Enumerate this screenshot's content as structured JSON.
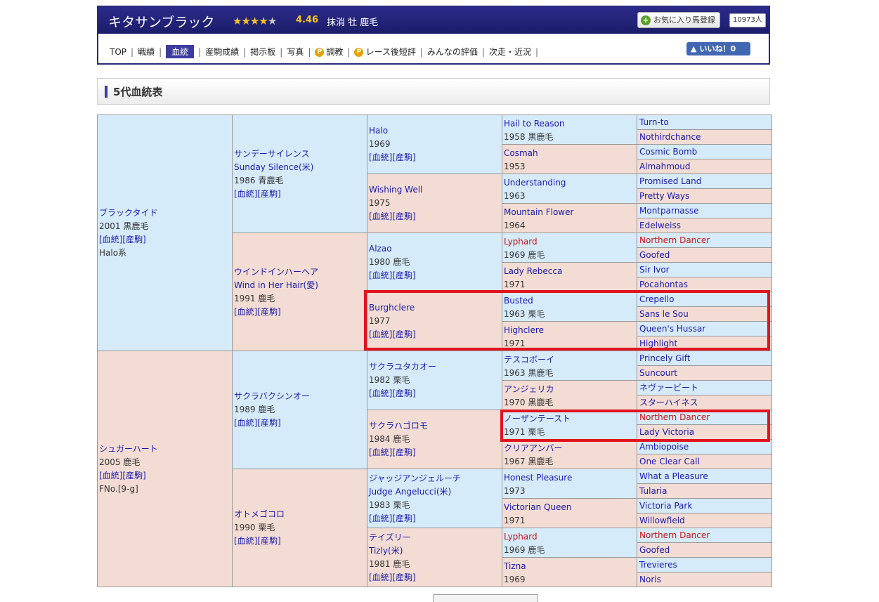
{
  "horse": {
    "name": "キタサンブラック",
    "rating": "4.46",
    "status": "抹消  牡  鹿毛",
    "stars": [
      "★",
      "★",
      "★",
      "★",
      "★"
    ],
    "favorite_label": "お気に入り馬登録",
    "favorite_count": "10973人",
    "like_label": "いいね！0"
  },
  "nav": {
    "top": "TOP",
    "results": "戦績",
    "pedigree": "血統",
    "offspring": "産駒成績",
    "bbs": "掲示板",
    "photos": "写真",
    "training": "調教",
    "comments": "レース後短評",
    "reviews": "みんなの評価",
    "next": "次走・近況",
    "sep": "|",
    "p_badge": "P"
  },
  "section": {
    "title": "5代血統表"
  },
  "links": {
    "pedigree": "[血統]",
    "offspring": "[産駒]"
  },
  "pedigree": {
    "g1": [
      {
        "name": "ブラックタイド",
        "info": "2001 黒鹿毛",
        "extra": "Halo系"
      },
      {
        "name": "シュガーハート",
        "info": "2005 鹿毛",
        "extra": "FNo.[9-g]"
      }
    ],
    "g2": [
      {
        "name": "サンデーサイレンス",
        "name2": "Sunday Silence(米)",
        "info": "1986 青鹿毛"
      },
      {
        "name": "ウインドインハーヘア",
        "name2": "Wind in Her Hair(愛)",
        "info": "1991 鹿毛"
      },
      {
        "name": "サクラバクシンオー",
        "info": "1989 鹿毛"
      },
      {
        "name": "オトメゴコロ",
        "info": "1990 栗毛"
      }
    ],
    "g3": [
      {
        "name": "Halo",
        "info": "1969"
      },
      {
        "name": "Wishing Well",
        "info": "1975"
      },
      {
        "name": "Alzao",
        "info": "1980 鹿毛"
      },
      {
        "name": "Burghclere",
        "info": "1977"
      },
      {
        "name": "サクラユタカオー",
        "info": "1982 栗毛"
      },
      {
        "name": "サクラハゴロモ",
        "info": "1984 鹿毛"
      },
      {
        "name": "ジャッジアンジェルーチ",
        "name2": "Judge Angelucci(米)",
        "info": "1983 栗毛"
      },
      {
        "name": "テイズリー",
        "name2": "Tizly(米)",
        "info": "1981 鹿毛"
      }
    ],
    "g4": [
      {
        "name": "Hail to Reason",
        "info": "1958 黒鹿毛"
      },
      {
        "name": "Cosmah",
        "info": "1953"
      },
      {
        "name": "Understanding",
        "info": "1963"
      },
      {
        "name": "Mountain Flower",
        "info": "1964"
      },
      {
        "name": "Lyphard",
        "info": "1969 鹿毛"
      },
      {
        "name": "Lady Rebecca",
        "info": "1971"
      },
      {
        "name": "Busted",
        "info": "1963 栗毛"
      },
      {
        "name": "Highclere",
        "info": "1971"
      },
      {
        "name": "テスコボーイ",
        "info": "1963 黒鹿毛"
      },
      {
        "name": "アンジェリカ",
        "info": "1970 黒鹿毛"
      },
      {
        "name": "ノーザンテースト",
        "info": "1971 栗毛"
      },
      {
        "name": "クリアアンバー",
        "info": "1967 黒鹿毛"
      },
      {
        "name": "Honest Pleasure",
        "info": "1973"
      },
      {
        "name": "Victorian Queen",
        "info": "1971"
      },
      {
        "name": "Lyphard",
        "info": "1969 鹿毛"
      },
      {
        "name": "Tizna",
        "info": "1969"
      }
    ],
    "g5": [
      "Turn-to",
      "Nothirdchance",
      "Cosmic Bomb",
      "Almahmoud",
      "Promised Land",
      "Pretty Ways",
      "Montparnasse",
      "Edelweiss",
      "Northern Dancer",
      "Goofed",
      "Sir Ivor",
      "Pocahontas",
      "Crepello",
      "Sans le Sou",
      "Queen's Hussar",
      "Highlight",
      "Princely Gift",
      "Suncourt",
      "ネヴァービート",
      "スターハイネス",
      "Northern Dancer",
      "Lady Victoria",
      "Ambiopoise",
      "One Clear Call",
      "What a Pleasure",
      "Tularia",
      "Victoria Park",
      "Willowfield",
      "Northern Dancer",
      "Goofed",
      "Trevieres",
      "Noris"
    ]
  },
  "colors": {
    "male_cell": "#d6ebfa",
    "female_cell": "#f3dcd3",
    "link": "#1a1ab0",
    "highlight_horse": "#c81414",
    "annotation_box": "#e0141e",
    "header_bg": "#1c1c6a"
  }
}
